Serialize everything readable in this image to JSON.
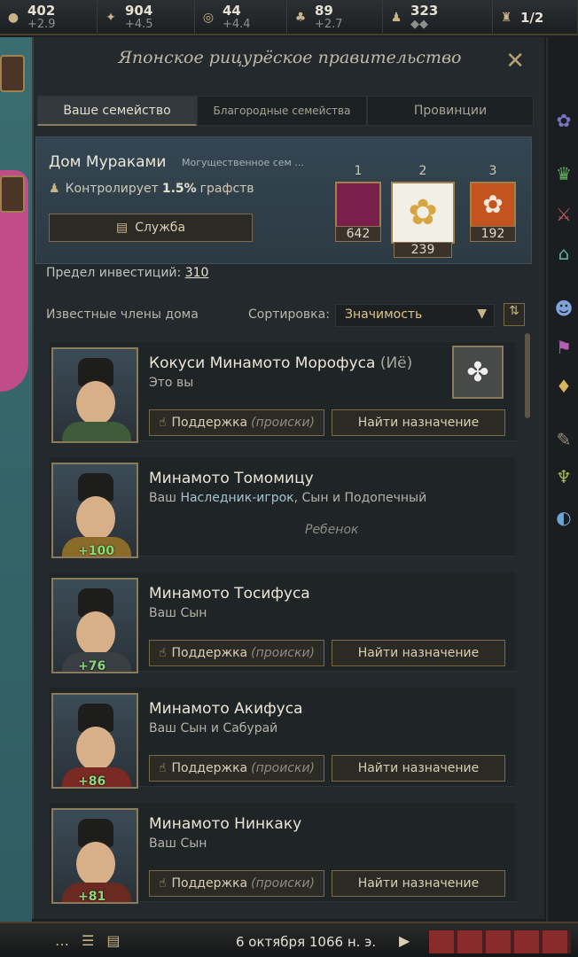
{
  "resources": [
    {
      "icon": "gold-coin-icon",
      "glyph": "●",
      "value": "402",
      "delta": "+2.9"
    },
    {
      "icon": "prestige-icon",
      "glyph": "✦",
      "value": "904",
      "delta": "+4.5"
    },
    {
      "icon": "piety-icon",
      "glyph": "◎",
      "value": "44",
      "delta": "+4.4"
    },
    {
      "icon": "dynasty-tree-icon",
      "glyph": "♣",
      "value": "89",
      "delta": "+2.7"
    },
    {
      "icon": "soldiers-icon",
      "glyph": "♟",
      "value": "323",
      "delta": "◆◆"
    },
    {
      "icon": "domain-limit-icon",
      "glyph": "♜",
      "value": "1/2",
      "delta": ""
    }
  ],
  "title": "Японское рицурёское правительство",
  "tabs": [
    "Ваше семейство",
    "Благородные семейства",
    "Провинции"
  ],
  "house": {
    "name": "Дом Мураками",
    "description": "Могущественное сем ...",
    "control_prefix": "Контролирует",
    "control_value": "1.5%",
    "control_suffix": "графств",
    "service_label": "Служба",
    "banners": [
      {
        "rank": "1",
        "count": "642",
        "color": "#7a1e4c"
      },
      {
        "rank": "2",
        "count": "239",
        "color": "#f2efe6"
      },
      {
        "rank": "3",
        "count": "192",
        "color": "#c4541f"
      }
    ]
  },
  "investment": {
    "label": "Предел инвестиций:",
    "value": "310"
  },
  "members": {
    "heading": "Известные члены дома",
    "sort_label": "Сортировка:",
    "sort_value": "Значимость",
    "items": [
      {
        "name": "Кокуси Минамото Морофуса",
        "suffix": "(Иё)",
        "relation": "Это вы",
        "relation_hl": "",
        "relation_tail": "",
        "score": "",
        "buttons": true,
        "child": ""
      },
      {
        "name": "Минамото Томомицу",
        "suffix": "",
        "relation": "Ваш",
        "relation_hl": "Наследник-игрок",
        "relation_tail": ", Сын и Подопечный",
        "score": "+100",
        "buttons": false,
        "child": "Ребенок"
      },
      {
        "name": "Минамото Тосифуса",
        "suffix": "",
        "relation": "Ваш Сын",
        "relation_hl": "",
        "relation_tail": "",
        "score": "+76",
        "buttons": true,
        "child": ""
      },
      {
        "name": "Минамото Акифуса",
        "suffix": "",
        "relation": "Ваш Сын и Сабурай",
        "relation_hl": "",
        "relation_tail": "",
        "score": "+86",
        "buttons": true,
        "child": ""
      },
      {
        "name": "Минамото Нинкаку",
        "suffix": "",
        "relation": "Ваш Сын",
        "relation_hl": "",
        "relation_tail": "",
        "score": "+81",
        "buttons": true,
        "child": ""
      }
    ],
    "support_label": "Поддержка",
    "support_hint": "(происки)",
    "assign_label": "Найти назначение"
  },
  "date": "6 октября 1066 н. э."
}
